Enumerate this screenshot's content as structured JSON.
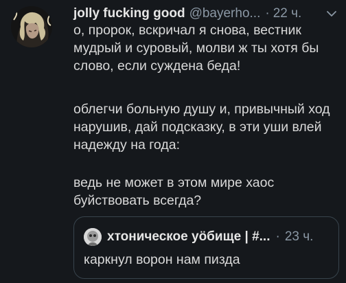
{
  "tweet": {
    "display_name": "jolly fucking good",
    "handle": "@bayerho...",
    "separator": "·",
    "time": "22 ч.",
    "paragraphs": [
      "о, пророк, вскричал я снова, вестник мудрый и суровый, молви ж ты хотя бы слово, если суждена беда!",
      "облегчи больную душу и, привычный ход нарушив, дай подсказку, в эти уши влей надежду на года:",
      "ведь не может в этом мире хаос буйствовать всегда?"
    ]
  },
  "quoted_tweet": {
    "display_name": "хтоническое уöбище | #...",
    "separator": "·",
    "time": "23 ч.",
    "text": "каркнул ворон нам пизда"
  },
  "icons": {
    "menu": "chevron-down-icon",
    "avatar": "avatar",
    "quote_avatar": "avatar"
  },
  "colors": {
    "background": "#15181c",
    "primary_text": "#d9d9d9",
    "secondary_text": "#8b98a5",
    "border": "#38444d"
  }
}
